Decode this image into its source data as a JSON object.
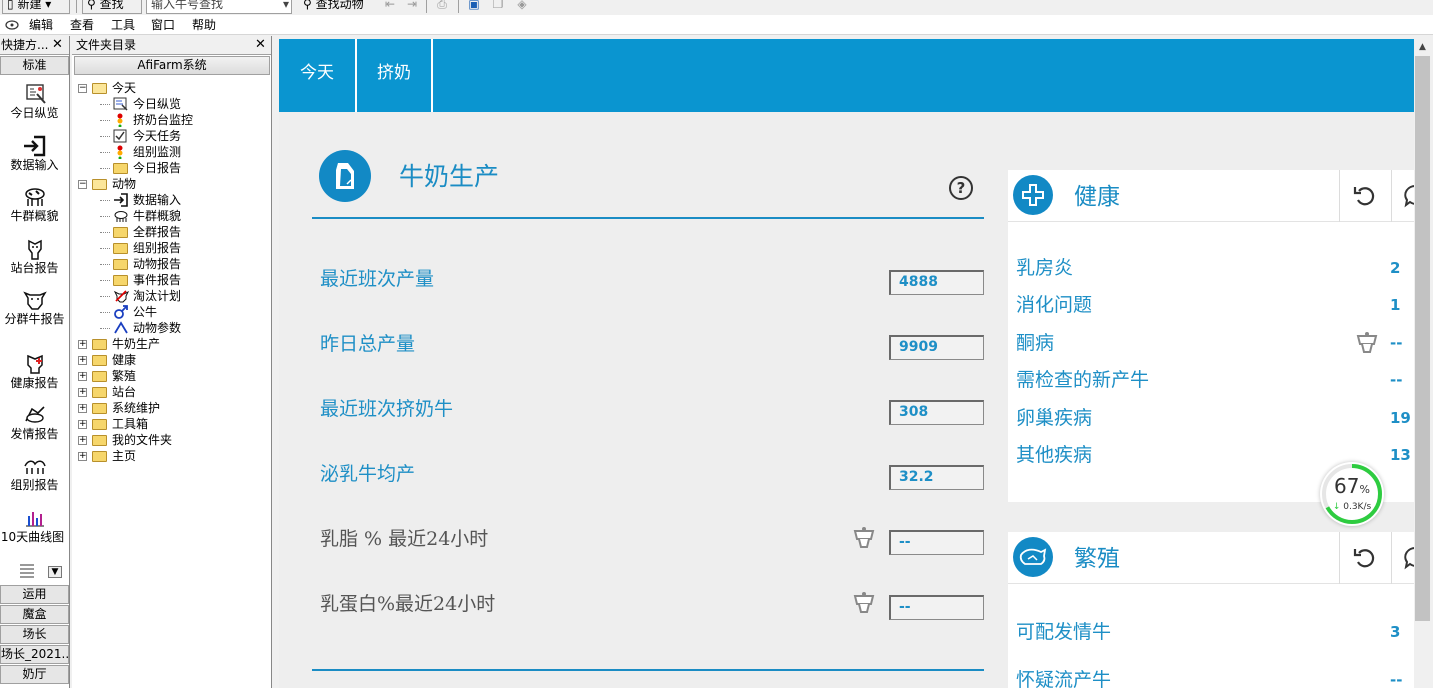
{
  "toolbar": {
    "new_label": "新建",
    "find_label": "查找",
    "search_placeholder": "输入牛号查找",
    "find_animal_label": "查找动物"
  },
  "menu": [
    "编辑",
    "查看",
    "工具",
    "窗口",
    "帮助"
  ],
  "quick_panel": {
    "title": "快捷方...",
    "section_top": "标准",
    "items": [
      "今日纵览",
      "数据输入",
      "牛群概貌",
      "站台报告",
      "分群牛报告",
      "健康报告",
      "发情报告",
      "组别报告",
      "10天曲线图"
    ],
    "sections_bottom": [
      "运用",
      "魔盒",
      "场长",
      "场长_2021...",
      "奶厅"
    ]
  },
  "tree_panel": {
    "title": "文件夹目录",
    "root": "AfiFarm系统",
    "nodes": [
      {
        "label": "今天",
        "level": 0,
        "exp": "−",
        "icon": "folder-open"
      },
      {
        "label": "今日纵览",
        "level": 1,
        "icon": "overview"
      },
      {
        "label": "挤奶台监控",
        "level": 1,
        "icon": "traffic-light"
      },
      {
        "label": "今天任务",
        "level": 1,
        "icon": "checklist"
      },
      {
        "label": "组别监测",
        "level": 1,
        "icon": "traffic-light"
      },
      {
        "label": "今日报告",
        "level": 1,
        "icon": "folder"
      },
      {
        "label": "动物",
        "level": 0,
        "exp": "−",
        "icon": "folder-open"
      },
      {
        "label": "数据输入",
        "level": 1,
        "icon": "data-entry"
      },
      {
        "label": "牛群概貌",
        "level": 1,
        "icon": "herd"
      },
      {
        "label": "全群报告",
        "level": 1,
        "icon": "folder"
      },
      {
        "label": "组别报告",
        "level": 1,
        "icon": "folder"
      },
      {
        "label": "动物报告",
        "level": 1,
        "icon": "folder"
      },
      {
        "label": "事件报告",
        "level": 1,
        "icon": "folder"
      },
      {
        "label": "淘汰计划",
        "level": 1,
        "icon": "cull"
      },
      {
        "label": "公牛",
        "level": 1,
        "icon": "bull"
      },
      {
        "label": "动物参数",
        "level": 1,
        "icon": "params"
      },
      {
        "label": "牛奶生产",
        "level": 0,
        "exp": "+",
        "icon": "folder"
      },
      {
        "label": "健康",
        "level": 0,
        "exp": "+",
        "icon": "folder"
      },
      {
        "label": "繁殖",
        "level": 0,
        "exp": "+",
        "icon": "folder"
      },
      {
        "label": "站台",
        "level": 0,
        "exp": "+",
        "icon": "folder"
      },
      {
        "label": "系统维护",
        "level": 0,
        "exp": "+",
        "icon": "folder"
      },
      {
        "label": "工具箱",
        "level": 0,
        "exp": "+",
        "icon": "folder"
      },
      {
        "label": "我的文件夹",
        "level": 0,
        "exp": "+",
        "icon": "folder"
      },
      {
        "label": "主页",
        "level": 0,
        "exp": "+",
        "icon": "folder"
      }
    ]
  },
  "top_nav": {
    "tabs": [
      "今天",
      "挤奶"
    ]
  },
  "milk": {
    "title": "牛奶生产",
    "kpis": [
      {
        "label": "最近班次产量",
        "value": "4888",
        "style": "blue",
        "icon": false
      },
      {
        "label": "昨日总产量",
        "value": "9909",
        "style": "blue",
        "icon": false
      },
      {
        "label": "最近班次挤奶牛",
        "value": "308",
        "style": "blue",
        "icon": false
      },
      {
        "label": "泌乳牛均产",
        "value": "32.2",
        "style": "blue",
        "icon": false
      },
      {
        "label": "乳脂 % 最近24小时",
        "value": "--",
        "style": "grey",
        "icon": true
      },
      {
        "label": "乳蛋白%最近24小时",
        "value": "--",
        "style": "grey",
        "icon": true
      }
    ]
  },
  "health": {
    "title": "健康",
    "rows": [
      {
        "label": "乳房炎",
        "value": "2",
        "icon": false
      },
      {
        "label": "消化问题",
        "value": "1",
        "icon": false
      },
      {
        "label": "酮病",
        "value": "--",
        "icon": true
      },
      {
        "label": "需检查的新产牛",
        "value": "--",
        "icon": false
      },
      {
        "label": "卵巢疾病",
        "value": "19",
        "icon": false
      },
      {
        "label": "其他疾病",
        "value": "13",
        "icon": false
      }
    ]
  },
  "breeding": {
    "title": "繁殖",
    "rows": [
      {
        "label": "可配发情牛",
        "value": "3"
      },
      {
        "label": "怀疑流产牛",
        "value": "--"
      }
    ]
  },
  "net_widget": {
    "percent": "67",
    "percent_unit": "%",
    "speed": "0.3K/s",
    "fraction": 0.67
  },
  "colors": {
    "accent": "#0a95d0",
    "text_blue": "#1e8fc6",
    "widget_green": "#2ecc40"
  }
}
